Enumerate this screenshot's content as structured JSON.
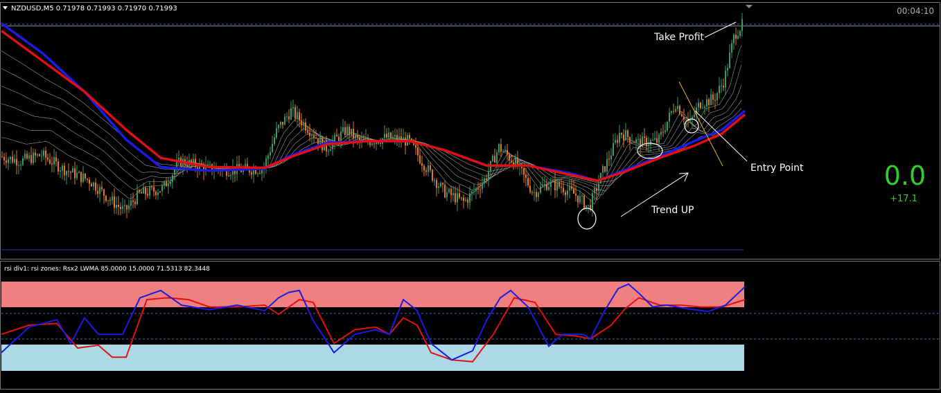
{
  "main_pane": {
    "header": "NZDUSD,M5  0.71978 0.71993 0.71970 0.71993",
    "timer": "00:04:10",
    "score_value": "0.0",
    "score_delta": "+17.1"
  },
  "annotations": {
    "take_profit": "Take Profit",
    "entry_point": "Entry Point",
    "trend_up": "Trend UP"
  },
  "indicator_pane": {
    "header": "rsi div1: rsi zones: Rsx2 LWMA 85.0000 15.0000 71.5313 82.3448"
  },
  "colors": {
    "background": "#000000",
    "bull_candle": "#3a9a6a",
    "bear_candle": "#e07a2a",
    "ma_slow": "#e01010",
    "ma_fast": "#1a1ae0",
    "ribbon": "#cfcfcf",
    "overbought_zone": "#f08080",
    "oversold_zone": "#add8e6",
    "rsi_fast": "#1a1ae0",
    "rsi_slow": "#e01010",
    "score": "#33cc33",
    "grid_dash": "#4a6fb0"
  },
  "chart_data": [
    {
      "type": "candlestick",
      "symbol": "NZDUSD",
      "timeframe": "M5",
      "last_ohlc": [
        0.71978,
        0.71993,
        0.7197,
        0.71993
      ],
      "price_trend": [
        [
          0,
          0.2
        ],
        [
          30,
          0.14
        ],
        [
          60,
          0.22
        ],
        [
          90,
          0.04
        ],
        [
          130,
          -0.12
        ],
        [
          160,
          -0.38
        ],
        [
          180,
          -0.52
        ],
        [
          200,
          -0.3
        ],
        [
          235,
          -0.22
        ],
        [
          260,
          0.14
        ],
        [
          300,
          0.04
        ],
        [
          340,
          0.02
        ],
        [
          380,
          0.04
        ],
        [
          400,
          0.55
        ],
        [
          420,
          0.8
        ],
        [
          450,
          0.52
        ],
        [
          470,
          0.3
        ],
        [
          500,
          0.55
        ],
        [
          520,
          0.38
        ],
        [
          560,
          0.45
        ],
        [
          590,
          0.4
        ],
        [
          610,
          0.12
        ],
        [
          640,
          -0.26
        ],
        [
          670,
          -0.4
        ],
        [
          700,
          -0.1
        ],
        [
          720,
          0.32
        ],
        [
          745,
          0.1
        ],
        [
          770,
          -0.28
        ],
        [
          790,
          -0.16
        ],
        [
          810,
          -0.2
        ],
        [
          830,
          -0.3
        ],
        [
          850,
          -0.48
        ],
        [
          870,
          0.0
        ],
        [
          895,
          0.52
        ],
        [
          920,
          0.38
        ],
        [
          950,
          0.4
        ],
        [
          975,
          0.9
        ],
        [
          995,
          0.62
        ],
        [
          1010,
          0.9
        ],
        [
          1030,
          0.95
        ],
        [
          1045,
          1.2
        ],
        [
          1060,
          1.8
        ],
        [
          1073,
          1.95
        ]
      ],
      "moving_averages": {
        "slow": [
          [
            0,
            1.85
          ],
          [
            60,
            1.45
          ],
          [
            120,
            1.05
          ],
          [
            180,
            0.55
          ],
          [
            230,
            0.18
          ],
          [
            300,
            0.06
          ],
          [
            380,
            0.05
          ],
          [
            420,
            0.2
          ],
          [
            470,
            0.36
          ],
          [
            530,
            0.4
          ],
          [
            590,
            0.4
          ],
          [
            640,
            0.28
          ],
          [
            700,
            0.08
          ],
          [
            760,
            0.08
          ],
          [
            820,
            -0.04
          ],
          [
            860,
            -0.12
          ],
          [
            900,
            0.0
          ],
          [
            950,
            0.18
          ],
          [
            1000,
            0.34
          ],
          [
            1040,
            0.5
          ],
          [
            1073,
            0.75
          ]
        ],
        "fast": [
          [
            0,
            1.95
          ],
          [
            60,
            1.55
          ],
          [
            120,
            1.05
          ],
          [
            180,
            0.42
          ],
          [
            230,
            0.06
          ],
          [
            300,
            0.01
          ],
          [
            380,
            0.04
          ],
          [
            420,
            0.22
          ],
          [
            470,
            0.38
          ],
          [
            530,
            0.4
          ],
          [
            590,
            0.4
          ],
          [
            640,
            0.28
          ],
          [
            700,
            0.08
          ],
          [
            760,
            0.08
          ],
          [
            820,
            -0.02
          ],
          [
            860,
            -0.12
          ],
          [
            900,
            0.02
          ],
          [
            950,
            0.2
          ],
          [
            1000,
            0.4
          ],
          [
            1040,
            0.55
          ],
          [
            1073,
            0.8
          ]
        ]
      }
    },
    {
      "type": "line",
      "title": "rsi div1: rsi zones: Rsx2 LWMA 85.0000 15.0000 71.5313 82.3448",
      "ylim": [
        0,
        100
      ],
      "zones": {
        "overbought": [
          71.5313,
          85
        ],
        "oversold": [
          15,
          25
        ]
      },
      "levels": [
        71.5313,
        82.3448,
        100,
        0
      ],
      "series": [
        {
          "values": [
            [
              0,
              20
            ],
            [
              40,
              48
            ],
            [
              80,
              56
            ],
            [
              100,
              30
            ],
            [
              120,
              58
            ],
            [
              140,
              40
            ],
            [
              175,
              40
            ],
            [
              200,
              80
            ],
            [
              230,
              88
            ],
            [
              260,
              72
            ],
            [
              300,
              67
            ],
            [
              340,
              72
            ],
            [
              380,
              66
            ],
            [
              400,
              80
            ],
            [
              415,
              86
            ],
            [
              430,
              88
            ],
            [
              450,
              55
            ],
            [
              480,
              20
            ],
            [
              510,
              40
            ],
            [
              540,
              45
            ],
            [
              560,
              40
            ],
            [
              580,
              78
            ],
            [
              600,
              66
            ],
            [
              620,
              30
            ],
            [
              650,
              12
            ],
            [
              680,
              22
            ],
            [
              700,
              55
            ],
            [
              720,
              80
            ],
            [
              735,
              88
            ],
            [
              760,
              70
            ],
            [
              790,
              27
            ],
            [
              810,
              40
            ],
            [
              840,
              40
            ],
            [
              850,
              35
            ],
            [
              870,
              65
            ],
            [
              890,
              90
            ],
            [
              905,
              95
            ],
            [
              920,
              85
            ],
            [
              940,
              70
            ],
            [
              960,
              72
            ],
            [
              990,
              68
            ],
            [
              1020,
              65
            ],
            [
              1045,
              72
            ],
            [
              1073,
              92
            ]
          ]
        },
        {
          "values": [
            [
              0,
              40
            ],
            [
              40,
              50
            ],
            [
              80,
              52
            ],
            [
              110,
              25
            ],
            [
              140,
              28
            ],
            [
              160,
              15
            ],
            [
              180,
              15
            ],
            [
              210,
              78
            ],
            [
              240,
              80
            ],
            [
              270,
              78
            ],
            [
              300,
              70
            ],
            [
              340,
              70
            ],
            [
              380,
              72
            ],
            [
              400,
              62
            ],
            [
              430,
              78
            ],
            [
              450,
              75
            ],
            [
              480,
              30
            ],
            [
              510,
              45
            ],
            [
              540,
              48
            ],
            [
              560,
              40
            ],
            [
              580,
              58
            ],
            [
              600,
              50
            ],
            [
              620,
              20
            ],
            [
              650,
              12
            ],
            [
              680,
              10
            ],
            [
              710,
              40
            ],
            [
              740,
              80
            ],
            [
              770,
              75
            ],
            [
              800,
              40
            ],
            [
              830,
              38
            ],
            [
              850,
              35
            ],
            [
              880,
              50
            ],
            [
              900,
              68
            ],
            [
              920,
              80
            ],
            [
              950,
              72
            ],
            [
              980,
              72
            ],
            [
              1010,
              70
            ],
            [
              1040,
              70
            ],
            [
              1073,
              78
            ]
          ]
        }
      ]
    }
  ]
}
